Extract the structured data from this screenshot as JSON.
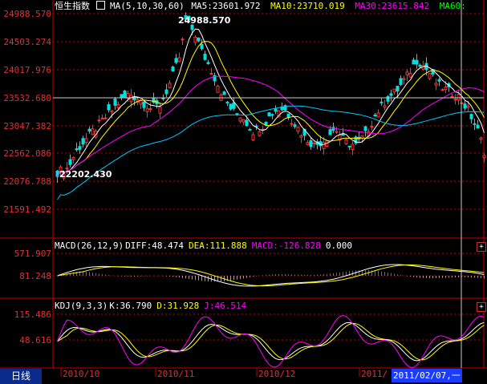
{
  "main_panel": {
    "index_name": "恒生指数",
    "ma_label": "MA(5,10,30,60)",
    "ma5": "MA5:23601.972",
    "ma10": "MA10:23710.019",
    "ma30": "MA30:23615.842",
    "ma60": "MA60:",
    "y_ticks": [
      "24988.570",
      "24503.274",
      "24017.976",
      "23532.680",
      "23047.382",
      "22562.086",
      "22076.788",
      "21591.492"
    ],
    "high_annotation": "24988.570",
    "low_annotation": "22202.430"
  },
  "macd_panel": {
    "label": "MACD(26,12,9)",
    "diff": "DIFF:48.474",
    "dea": "DEA:111.888",
    "macd": "MACD:-126.828",
    "zero": "0.000",
    "y_ticks": [
      "571.907",
      "81.248"
    ]
  },
  "kdj_panel": {
    "label": "KDJ(9,3,3)",
    "k": "K:36.790",
    "d": "D:31.928",
    "j": "J:46.514",
    "y_ticks": [
      "115.486",
      "48.616"
    ]
  },
  "x_axis": {
    "labels": [
      "2010/10",
      "2010/11",
      "2010/12",
      "2011/"
    ]
  },
  "period_tab": "日线",
  "crosshair_date": "2011/02/07,一",
  "expand_symbol": "+",
  "colors": {
    "up": "#ff3030",
    "down": "#00e0e0",
    "ma5": "#ffffff",
    "ma10": "#ffff00",
    "ma30": "#ff00ff",
    "ma60": "#00ff00",
    "grid": "#c00000",
    "label": "#e03030",
    "tab": "#0a2a8c",
    "readout": "#1a3cff"
  }
}
